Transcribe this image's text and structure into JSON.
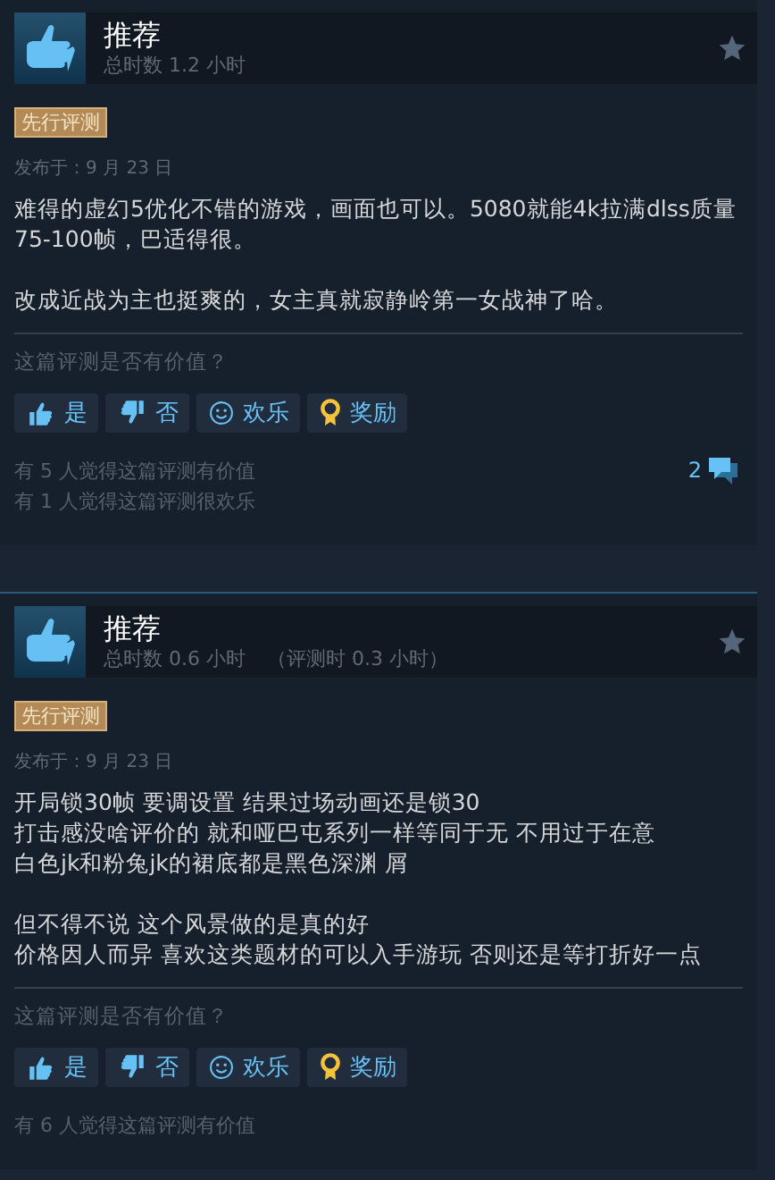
{
  "reviews": [
    {
      "verdict": "推荐",
      "playtime": "总时数 1.2 小时",
      "badge": "先行评测",
      "posted": "发布于：9 月 23 日",
      "paragraphs": [
        [
          "难得的虚幻5优化不错的游戏，画面也可以。5080就能4k拉满dlss质量75-100帧，巴适得很。"
        ],
        [
          "改成近战为主也挺爽的，女主真就寂静岭第一女战神了哈。"
        ]
      ],
      "prompt": "这篇评测是否有价值？",
      "buttons": [
        {
          "kind": "yes",
          "label": "是"
        },
        {
          "kind": "no",
          "label": "否"
        },
        {
          "kind": "funny",
          "label": "欢乐"
        },
        {
          "kind": "award",
          "label": "奖励"
        }
      ],
      "votes": [
        "有 5 人觉得这篇评测有价值",
        "有 1 人觉得这篇评测很欢乐"
      ],
      "comments": "2"
    },
    {
      "verdict": "推荐",
      "playtime": "总时数 0.6 小时",
      "review_time": "（评测时 0.3 小时）",
      "badge": "先行评测",
      "posted": "发布于：9 月 23 日",
      "paragraphs": [
        [
          "开局锁30帧 要调设置 结果过场动画还是锁30",
          "打击感没啥评价的 就和哑巴屯系列一样等同于无 不用过于在意",
          "白色jk和粉兔jk的裙底都是黑色深渊 屑"
        ],
        [
          "但不得不说 这个风景做的是真的好",
          "价格因人而异 喜欢这类题材的可以入手游玩 否则还是等打折好一点"
        ]
      ],
      "prompt": "这篇评测是否有价值？",
      "buttons": [
        {
          "kind": "yes",
          "label": "是"
        },
        {
          "kind": "no",
          "label": "否"
        },
        {
          "kind": "funny",
          "label": "欢乐"
        },
        {
          "kind": "award",
          "label": "奖励"
        }
      ],
      "votes": [
        "有 6 人觉得这篇评测有价值"
      ]
    }
  ]
}
